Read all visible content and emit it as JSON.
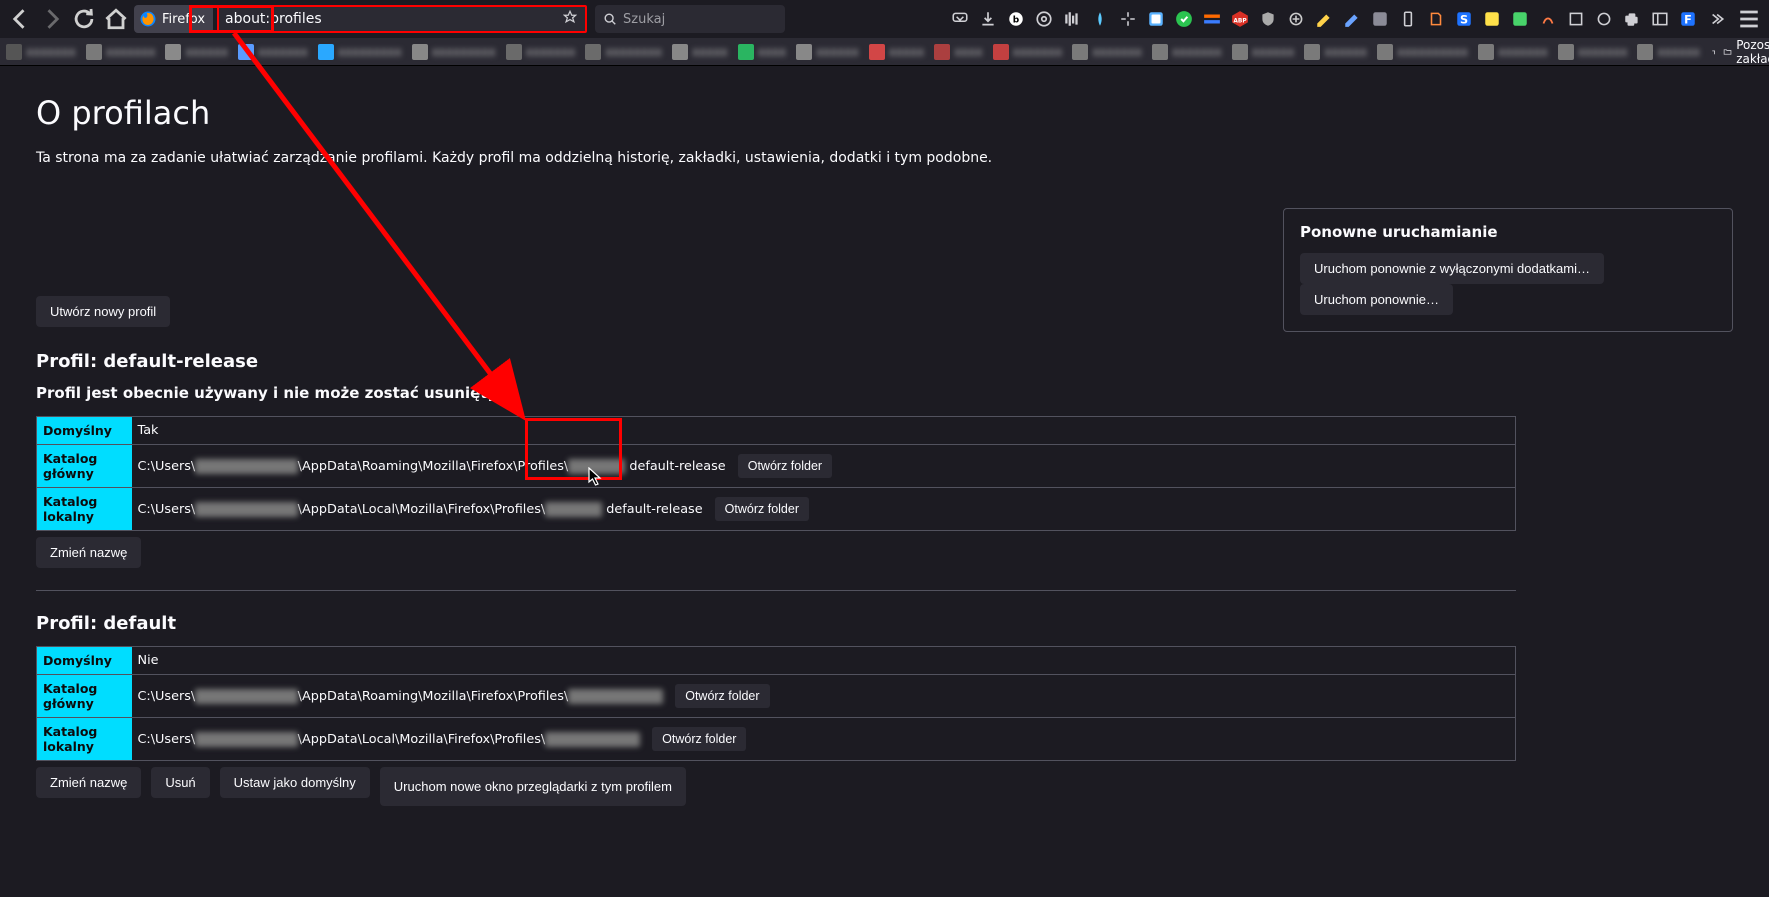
{
  "identity": {
    "label": "Firefox"
  },
  "urlbar": {
    "value": "about:profiles"
  },
  "searchbar": {
    "placeholder": "Szukaj"
  },
  "bookmark_overflow": "Pozostałe zakładl",
  "page": {
    "title": "O profilach",
    "subtitle": "Ta strona ma za zadanie ułatwiać zarządzanie profilami. Każdy profil ma oddzielną historię, zakładki, ustawienia, dodatki i tym podobne."
  },
  "restart": {
    "heading": "Ponowne uruchamianie",
    "disable_addons": "Uruchom ponownie z wyłączonymi dodatkami…",
    "normal": "Uruchom ponownie…"
  },
  "buttons": {
    "create_profile": "Utwórz nowy profil",
    "rename": "Zmień nazwę",
    "delete": "Usuń",
    "set_default": "Ustaw jako domyślny",
    "launch": "Uruchom nowe okno przeglądarki z tym profilem",
    "open_folder": "Otwórz folder"
  },
  "labels": {
    "default": "Domyślny",
    "root_dir": "Katalog główny",
    "local_dir": "Katalog lokalny"
  },
  "values": {
    "yes": "Tak",
    "no": "Nie"
  },
  "profiles": [
    {
      "heading": "Profil: default-release",
      "in_use_note": "Profil jest obecnie używany i nie może zostać usunięty.",
      "is_default": "Tak",
      "root_path_prefix": "C:\\Users\\",
      "root_path_mid": "\\AppData\\Roaming\\Mozilla\\Firefox\\Profiles\\",
      "root_path_suffix": "default-release",
      "local_path_prefix": "C:\\Users\\",
      "local_path_mid": "\\AppData\\Local\\Mozilla\\Firefox\\Profiles\\",
      "local_path_suffix": "default-release"
    },
    {
      "heading": "Profil: default",
      "is_default": "Nie",
      "root_path_prefix": "C:\\Users\\",
      "root_path_mid": "\\AppData\\Roaming\\Mozilla\\Firefox\\Profiles\\",
      "root_path_suffix": "",
      "local_path_prefix": "C:\\Users\\",
      "local_path_mid": "\\AppData\\Local\\Mozilla\\Firefox\\Profiles\\",
      "local_path_suffix": ""
    }
  ]
}
